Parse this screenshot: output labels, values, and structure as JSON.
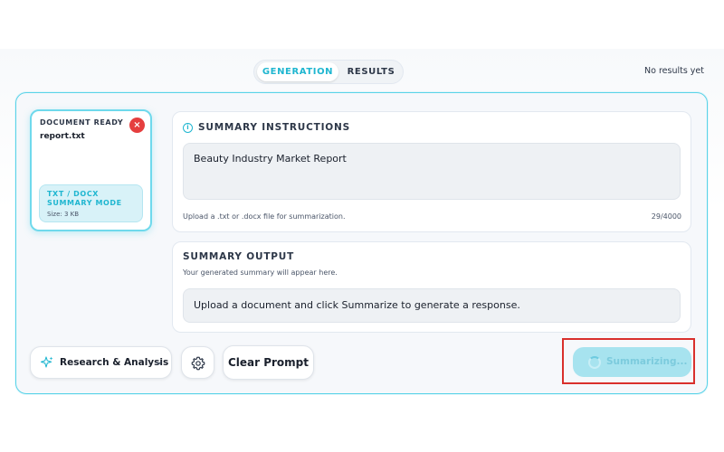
{
  "tabs": {
    "generation": "GENERATION",
    "results": "RESULTS"
  },
  "results_status": "No results yet",
  "document": {
    "status": "DOCUMENT READY",
    "file_name": "report.txt",
    "remove_symbol": "×",
    "mode_line1": "TXT / DOCX",
    "mode_line2": "SUMMARY MODE",
    "size": "Size: 3 KB"
  },
  "instructions": {
    "title": "SUMMARY INSTRUCTIONS",
    "info_symbol": "i",
    "value": "Beauty Industry Market Report",
    "hint": "Upload a .txt or .docx file for summarization.",
    "counter": "29/4000"
  },
  "output": {
    "title": "SUMMARY OUTPUT",
    "subtitle": "Your generated summary will appear here.",
    "text": "Upload a document and click Summarize to generate a response."
  },
  "toolbar": {
    "mode_label": "Research & Analysis",
    "clear_label": "Clear Prompt",
    "submit_label": "Summarizing..."
  },
  "colors": {
    "accent": "#1fb6d0",
    "card_border": "#59d3e8",
    "danger": "#e53e3e",
    "submit_disabled": "#a7e3ef",
    "highlight": "#d9302c"
  },
  "icons": {
    "remove": "close-icon",
    "info": "info-icon",
    "mode": "sparkle-icon",
    "dropdown": "chevron-down-icon",
    "settings": "gear-icon",
    "loading": "spinner-icon"
  }
}
